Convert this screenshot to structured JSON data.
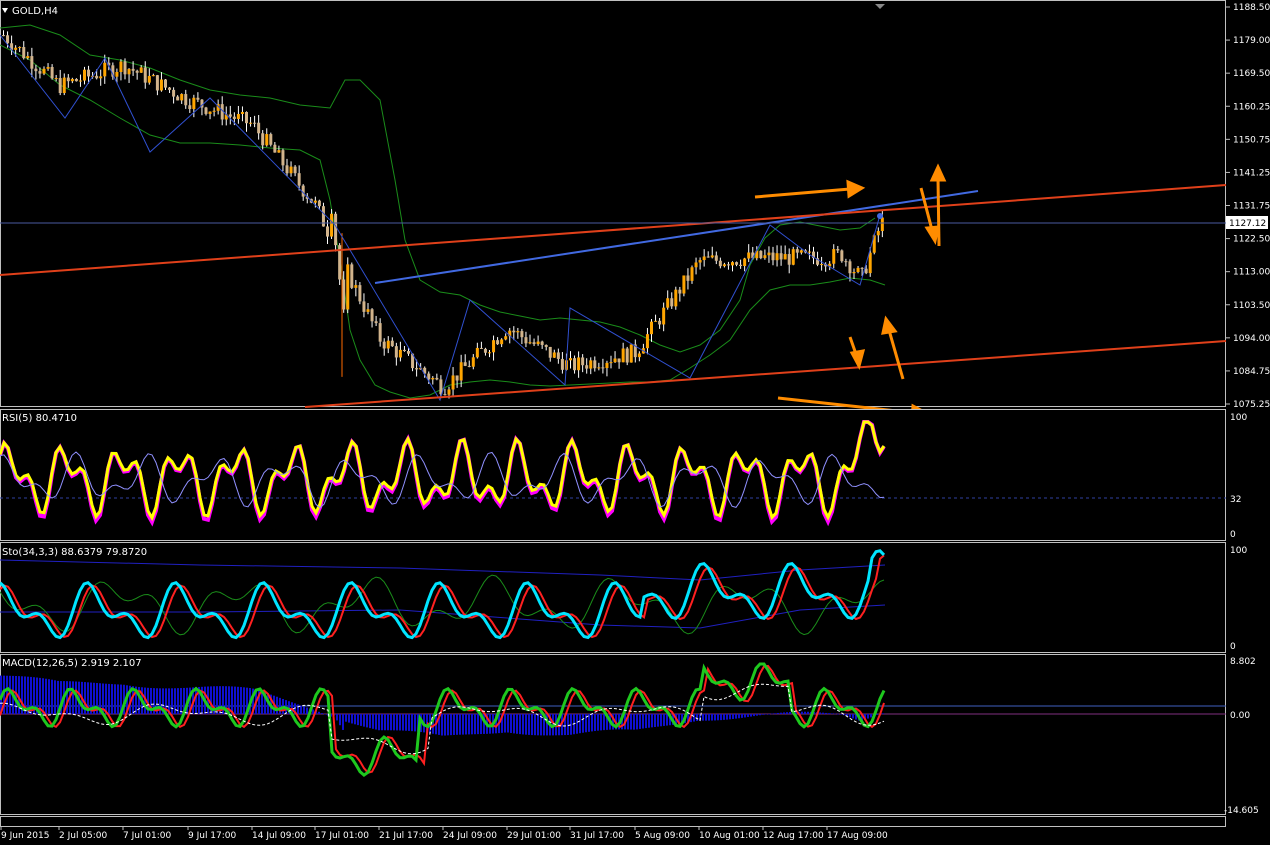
{
  "symbol_title": "GOLD,H4",
  "current_price": "1127.12",
  "colors": {
    "background": "#000000",
    "frame": "#c0c0c0",
    "bull_candle": "#ffa500",
    "bear_candle": "#d2b48c",
    "wick": "#ffffff",
    "bollinger": "#1a8c1a",
    "trendline_blue": "#4169e1",
    "channel_red": "#e0401a",
    "arrow": "#ff8c00",
    "rsi_main": "#ffff00",
    "rsi_shadow": "#ff00ff",
    "stoch_main": "#00e5ff",
    "stoch_signal": "#ff2020",
    "macd_hist": "#1010d0",
    "macd_fast": "#1ec81e",
    "macd_slow": "#ff2020",
    "macd_signal": "#ffffff"
  },
  "price_axis": {
    "ticks": [
      "1188.50",
      "1179.00",
      "1169.50",
      "1160.25",
      "1150.75",
      "1141.25",
      "1131.75",
      "1122.50",
      "1113.00",
      "1103.50",
      "1094.00",
      "1084.75",
      "1075.25"
    ]
  },
  "time_axis": {
    "labels": [
      "9 Jun 2015",
      "2 Jul 05:00",
      "7 Jul 01:00",
      "9 Jul 17:00",
      "14 Jul 09:00",
      "17 Jul 01:00",
      "21 Jul 17:00",
      "24 Jul 09:00",
      "29 Jul 01:00",
      "31 Jul 17:00",
      "5 Aug 09:00",
      "10 Aug 01:00",
      "12 Aug 17:00",
      "17 Aug 09:00"
    ]
  },
  "rsi": {
    "title": "RSI(5) 80.4710",
    "ticks": [
      "100",
      "32",
      "0"
    ]
  },
  "stochastic": {
    "title": "Sto(34,3,3) 88.6379 79.8720",
    "ticks": [
      "100",
      "0"
    ]
  },
  "macd": {
    "title": "MACD(12,26,5) 2.919 2.107",
    "ticks": [
      "8.802",
      "0.00",
      "-14.605"
    ]
  },
  "chart_data": {
    "type": "line",
    "title": "GOLD,H4",
    "ylim": [
      1075.25,
      1188.5
    ],
    "price_path": [
      {
        "x": "9 Jun 2015",
        "y": 1181
      },
      {
        "x": "2 Jul 05:00",
        "y": 1166
      },
      {
        "x": "7 Jul 01:00",
        "y": 1172
      },
      {
        "x": "9 Jul 17:00",
        "y": 1162
      },
      {
        "x": "14 Jul 09:00",
        "y": 1155
      },
      {
        "x": "17 Jul 01:00",
        "y": 1132
      },
      {
        "x": "21 Jul 17:00",
        "y": 1094
      },
      {
        "x": "24 Jul 09:00",
        "y": 1080
      },
      {
        "x": "29 Jul 01:00",
        "y": 1097
      },
      {
        "x": "31 Jul 17:00",
        "y": 1086
      },
      {
        "x": "5 Aug 09:00",
        "y": 1090
      },
      {
        "x": "10 Aug 01:00",
        "y": 1116
      },
      {
        "x": "12 Aug 17:00",
        "y": 1117
      },
      {
        "x": "17 Aug 09:00",
        "y": 1117
      }
    ],
    "last_price": 1127.12,
    "rsi_last": 80.471,
    "sto_main_last": 88.6379,
    "sto_signal_last": 79.872,
    "macd_last": 2.919,
    "macd_signal_last": 2.107
  }
}
